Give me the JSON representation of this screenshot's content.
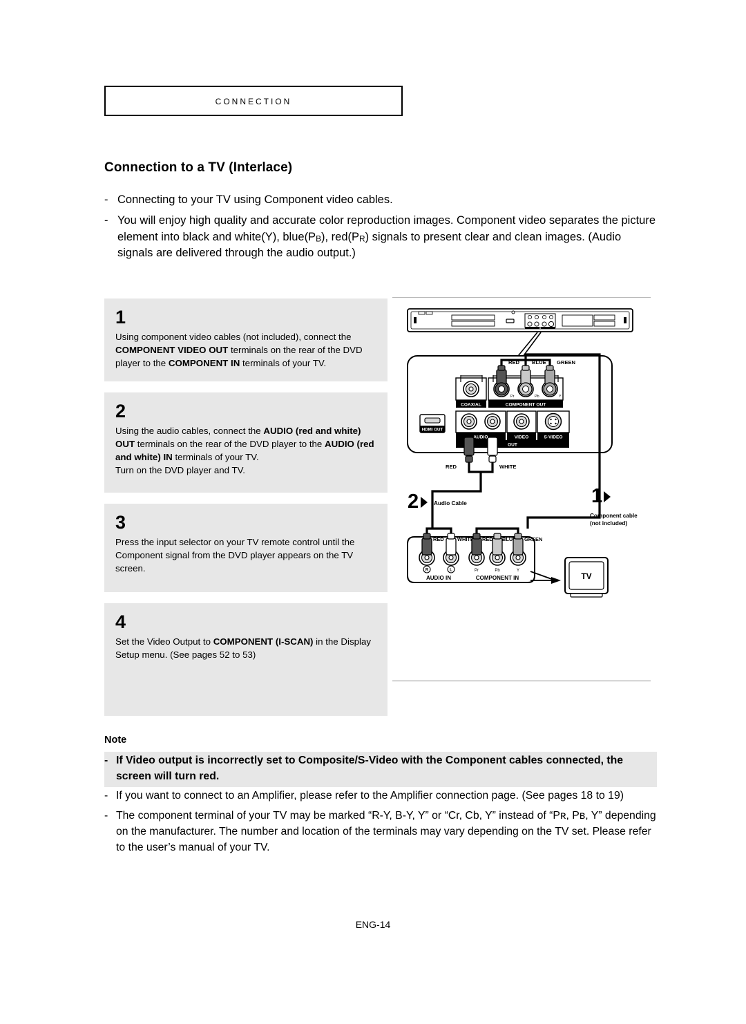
{
  "chapter": {
    "title": "Connection"
  },
  "section": {
    "heading": "Connection to a TV (Interlace)"
  },
  "intro": {
    "dash": "-",
    "bullets": [
      {
        "text": "Connecting to your TV using Component video cables."
      },
      {
        "text": "You will enjoy high quality and accurate color reproduction images. Component video separates the picture element into black and white(Y), blue(P",
        "sub1": "B",
        "mid": "), red(P",
        "sub2": "R",
        "tail": ") signals to present clear and clean images. (Audio signals are delivered through the audio output.)"
      }
    ]
  },
  "steps": [
    {
      "number": "1",
      "parts": [
        {
          "text": "Using component video cables (not included), connect the ",
          "bold": false
        },
        {
          "text": "COMPONENT VIDEO OUT",
          "bold": true
        },
        {
          "text": " terminals on the rear of the DVD player to the ",
          "bold": false
        },
        {
          "text": "COMPONENT IN",
          "bold": true
        },
        {
          "text": " terminals of your TV.",
          "bold": false
        }
      ]
    },
    {
      "number": "2",
      "parts": [
        {
          "text": "Using the audio cables, connect the ",
          "bold": false
        },
        {
          "text": "AUDIO (red and white) OUT",
          "bold": true
        },
        {
          "text": " terminals on the rear of the DVD player to the ",
          "bold": false
        },
        {
          "text": "AUDIO (red and white) IN",
          "bold": true
        },
        {
          "text": " terminals of your TV.",
          "bold": false
        },
        {
          "text": "\nTurn on the DVD player and TV.",
          "bold": false
        }
      ]
    },
    {
      "number": "3",
      "parts": [
        {
          "text": "Press the input selector on your TV remote control until the Component signal from the DVD player appears on the TV screen.",
          "bold": false
        }
      ]
    },
    {
      "number": "4",
      "parts": [
        {
          "text": "Set the Video Output to ",
          "bold": false
        },
        {
          "text": "COMPONENT (I-SCAN)",
          "bold": true
        },
        {
          "text": " in the Display Setup menu. (See pages 52 to 53)",
          "bold": false
        }
      ]
    }
  ],
  "diagram": {
    "dvd_rear_panel": {
      "jack_labels": {
        "coaxial": "COAXIAL",
        "component_out": "COMPONENT OUT",
        "component_pins": [
          "Pr",
          "Pb",
          "Y"
        ],
        "hdmi_out": "HDMI OUT",
        "audio": "AUDIO",
        "video": "VIDEO",
        "svideo": "S-VIDEO",
        "out": "OUT"
      },
      "plug_labels_component": [
        "RED",
        "BLUE",
        "GREEN"
      ],
      "plug_labels_audio": [
        "RED",
        "WHITE"
      ]
    },
    "tv_panel": {
      "audio_in": "AUDIO IN",
      "component_in": "COMPONENT IN",
      "audio_pins": [
        "R",
        "L"
      ],
      "component_pins": [
        "Pr",
        "Pb",
        "Y"
      ],
      "plug_labels_audio": [
        "RED",
        "WHITE"
      ],
      "plug_labels_component": [
        "RED",
        "BLUE",
        "GREEN"
      ]
    },
    "callouts": [
      {
        "number": "1",
        "caption_line1": "Component cable",
        "caption_line2": "(not included)"
      },
      {
        "number": "2",
        "caption_line1": "Audio Cable",
        "caption_line2": ""
      }
    ],
    "tv_label": "TV"
  },
  "note": {
    "label": "Note",
    "dash": "-",
    "items": [
      {
        "highlight": true,
        "text": "If Video output is incorrectly set to Composite/S-Video with the Component cables connected, the screen will turn red."
      },
      {
        "highlight": false,
        "text": "If you want to connect to an Amplifier, please refer to the Amplifier connection page. (See pages 18 to 19)"
      },
      {
        "highlight": false,
        "text": "The component terminal of your TV may be marked “R-Y, B-Y, Y” or “Cr, Cb, Y” instead of “Pʀ, Pʙ, Y” depending on the manufacturer. The number and location of the terminals may vary depending on the TV set. Please refer to the user’s manual of your TV."
      }
    ]
  },
  "footer": {
    "page": "ENG-14"
  },
  "colors": {
    "panel_gray": "#e7e7e7",
    "divider": "#b9b9b9",
    "red_plug": "#555555",
    "blue_plug": "#c9c9c9",
    "green_plug": "#a8a8a8"
  }
}
